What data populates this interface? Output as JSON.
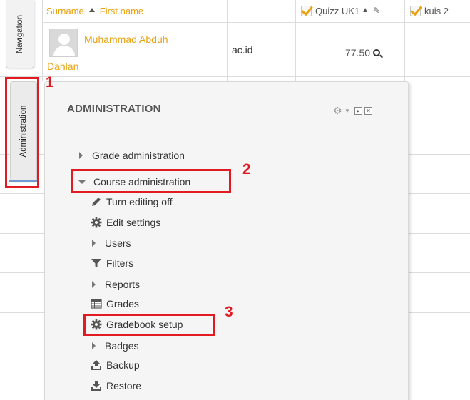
{
  "gradebook": {
    "col_surname": "Surname",
    "col_firstname": "First name",
    "col_quiz1": "Quizz UK1",
    "col_quiz2": "kuis 2",
    "student_name_line1": "Muhammad Abduh",
    "student_name_line2": "Dahlan",
    "email_fragment": "ac.id",
    "grade": "77.50"
  },
  "dock": {
    "navigation": "Navigation",
    "administration": "Administration"
  },
  "admin_block": {
    "title": "ADMINISTRATION",
    "items": [
      {
        "label": "Grade administration",
        "icon": "arrow-right"
      },
      {
        "label": "Course administration",
        "icon": "arrow-down"
      },
      {
        "label": "Turn editing off",
        "icon": "pencil-icon"
      },
      {
        "label": "Edit settings",
        "icon": "gear-icon"
      },
      {
        "label": "Users",
        "icon": "arrow-right"
      },
      {
        "label": "Filters",
        "icon": "filter-icon"
      },
      {
        "label": "Reports",
        "icon": "arrow-right"
      },
      {
        "label": "Grades",
        "icon": "table-icon"
      },
      {
        "label": "Gradebook setup",
        "icon": "gear-icon"
      },
      {
        "label": "Badges",
        "icon": "arrow-right"
      },
      {
        "label": "Backup",
        "icon": "upload-icon"
      },
      {
        "label": "Restore",
        "icon": "download-icon"
      }
    ]
  },
  "annotations": {
    "step1": "1",
    "step2": "2",
    "step3": "3",
    "color": "#e21b23"
  },
  "colors": {
    "link": "#e8a20e",
    "panel_bg": "#f5f5f5",
    "dock_active": "#6d9ad3"
  }
}
